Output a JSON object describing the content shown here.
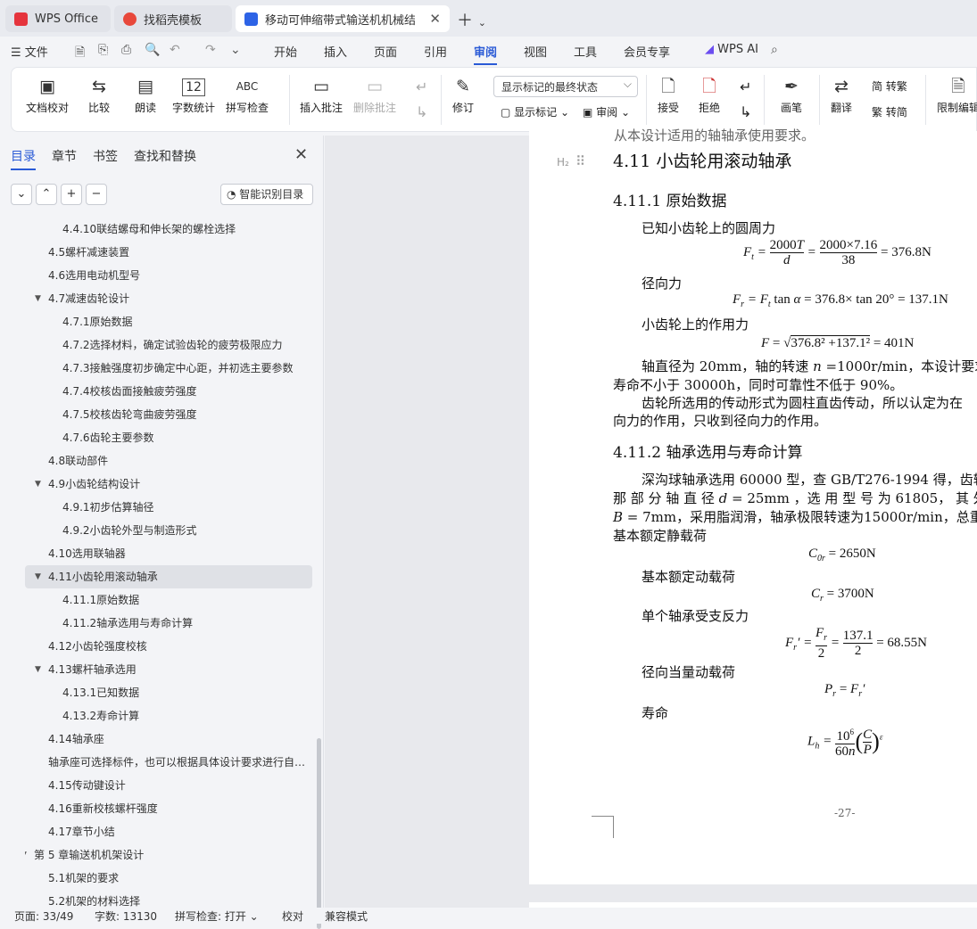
{
  "tabs": [
    {
      "label": "WPS Office"
    },
    {
      "label": "找稻壳模板"
    },
    {
      "label": "移动可伸缩带式输送机机械结构"
    }
  ],
  "menu": {
    "file": "文件",
    "items": [
      "开始",
      "插入",
      "页面",
      "引用",
      "审阅",
      "视图",
      "工具",
      "会员专享"
    ],
    "ai": "WPS AI"
  },
  "ribbon": {
    "proofread": "文档校对",
    "compare": "比较",
    "read": "朗读",
    "wordcount": "字数统计",
    "spellcheck": "拼写检查",
    "spell_glyph": "ABC",
    "count_glyph": "12",
    "insert_comment": "插入批注",
    "delete_comment": "删除批注",
    "track": "修订",
    "markup_select": "显示标记的最终状态",
    "show_markup": "显示标记",
    "review": "审阅",
    "accept": "接受",
    "reject": "拒绝",
    "pen": "画笔",
    "translate": "翻译",
    "to_trad": "简 转繁",
    "to_simp": "繁 转简",
    "restrict": "限制编辑"
  },
  "sidebar": {
    "tabs": [
      "目录",
      "章节",
      "书签",
      "查找和替换"
    ],
    "smart_toc": "智能识别目录",
    "toc": [
      {
        "label": "4.4.10联结螺母和伸长架的螺栓选择",
        "level": 3
      },
      {
        "label": "4.5螺杆减速装置",
        "level": 2
      },
      {
        "label": "4.6选用电动机型号",
        "level": 2
      },
      {
        "label": "4.7减速齿轮设计",
        "level": 2,
        "expanded": true
      },
      {
        "label": "4.7.1原始数据",
        "level": 3
      },
      {
        "label": "4.7.2选择材料，确定试验齿轮的疲劳极限应力",
        "level": 3
      },
      {
        "label": "4.7.3接触强度初步确定中心距，并初选主要参数",
        "level": 3
      },
      {
        "label": "4.7.4校核齿面接触疲劳强度",
        "level": 3
      },
      {
        "label": "4.7.5校核齿轮弯曲疲劳强度",
        "level": 3
      },
      {
        "label": "4.7.6齿轮主要参数",
        "level": 3
      },
      {
        "label": "4.8联动部件",
        "level": 2
      },
      {
        "label": "4.9小齿轮结构设计",
        "level": 2,
        "expanded": true
      },
      {
        "label": "4.9.1初步估算轴径",
        "level": 3
      },
      {
        "label": "4.9.2小齿轮外型与制造形式",
        "level": 3
      },
      {
        "label": "4.10选用联轴器",
        "level": 2
      },
      {
        "label": "4.11小齿轮用滚动轴承",
        "level": 2,
        "expanded": true,
        "selected": true
      },
      {
        "label": "4.11.1原始数据",
        "level": 3
      },
      {
        "label": "4.11.2轴承选用与寿命计算",
        "level": 3
      },
      {
        "label": "4.12小齿轮强度校核",
        "level": 2
      },
      {
        "label": "4.13螺杆轴承选用",
        "level": 2,
        "expanded": true
      },
      {
        "label": "4.13.1已知数据",
        "level": 3
      },
      {
        "label": "4.13.2寿命计算",
        "level": 3
      },
      {
        "label": "4.14轴承座",
        "level": 2
      },
      {
        "label": "轴承座可选择标件，也可以根据具体设计要求进行自行设计",
        "level": 2
      },
      {
        "label": "4.15传动键设计",
        "level": 2
      },
      {
        "label": "4.16重新校核螺杆强度",
        "level": 2
      },
      {
        "label": "4.17章节小结",
        "level": 2
      },
      {
        "label": "第 5 章输送机机架设计",
        "level": 1,
        "expanded": true
      },
      {
        "label": "5.1机架的要求",
        "level": 2
      },
      {
        "label": "5.2机架的材料选择",
        "level": 2
      }
    ]
  },
  "document": {
    "h2_badge": "H₂",
    "h2": "4.11  小齿轮用滚动轴承",
    "h3a": "4.11.1  原始数据",
    "p1": "已知小齿轮上的圆周力",
    "p2": "径向力",
    "p3": "小齿轮上的作用力",
    "p4": "轴直径为 20mm，轴的转速",
    "p4b": "，本设计要求",
    "p4c": "寿命不小于 30000h，同时可靠性不低于 90%。",
    "p5": "齿轮所选用的传动形式为圆柱直齿传动，所以认定为在",
    "p5b": "向力的作用，只收到径向力的作用。",
    "h3b": "4.11.2  轴承选用与寿命计算",
    "p6": "深沟球轴承选用 60000 型，查 GB/T276-1994 得，齿轮",
    "p6b": "那 部 分 轴 直 径",
    "p6c": "，选 用 型 号 为  61805， 其 外 径",
    "p6d": "，采用脂润滑，轴承极限转速为15000r/min，总重",
    "p7": "基本额定静载荷",
    "p8": "基本额定动载荷",
    "p9": "单个轴承受支反力",
    "p10": "径向当量动载荷",
    "p11": "寿命",
    "page_no": "-27-"
  },
  "status": {
    "page": "页面: 33/49",
    "words": "字数: 13130",
    "spell": "拼写检查: 打开",
    "proof": "校对",
    "compat": "兼容模式"
  }
}
